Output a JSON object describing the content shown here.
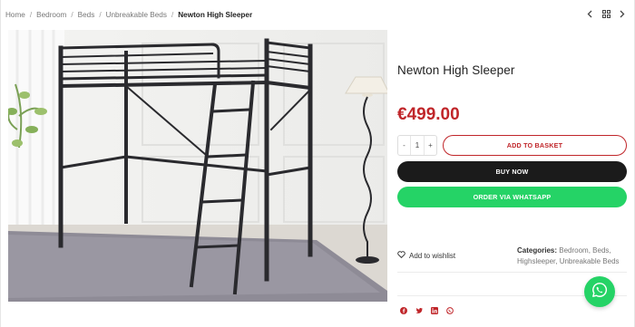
{
  "breadcrumb": {
    "items": [
      "Home",
      "Bedroom",
      "Beds",
      "Unbreakable Beds"
    ],
    "separator": "/",
    "current": "Newton High Sleeper"
  },
  "product": {
    "title": "Newton High Sleeper",
    "price": "€499.00",
    "quantity": "1",
    "qty_minus": "-",
    "qty_plus": "+"
  },
  "actions": {
    "add_to_basket": "ADD TO BASKET",
    "buy_now": "BUY NOW",
    "order_whatsapp": "ORDER VIA WHATSAPP",
    "wishlist": "Add to wishlist"
  },
  "categories": {
    "label": "Categories:",
    "items": [
      "Bedroom",
      "Beds",
      "Highsleeper",
      "Unbreakable Beds"
    ]
  },
  "icons": {
    "prev": "chevron-left-icon",
    "grid": "grid-icon",
    "next": "chevron-right-icon",
    "wishlist": "heart-icon",
    "share": [
      "facebook-icon",
      "twitter-icon",
      "linkedin-icon",
      "whatsapp-icon"
    ],
    "floating": "whatsapp-icon"
  },
  "colors": {
    "price": "#c0262a",
    "basket_border": "#c0262a",
    "buy_bg": "#1b1b1b",
    "whatsapp": "#25d366",
    "share_icons": "#c0262a"
  }
}
